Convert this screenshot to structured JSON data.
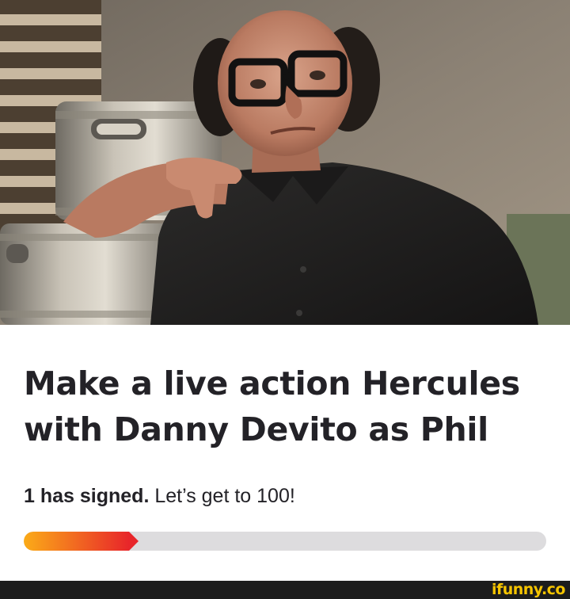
{
  "hero": {
    "image_name": "man-leaning-on-beer-kegs-photo"
  },
  "petition": {
    "title": "Make a live action Hercules with Danny Devito as Phil",
    "signed_count_text": "1 has signed.",
    "goal_text": " Let’s get to 100!",
    "progress_fraction": 0.22,
    "progress_colors": [
      "#fbab18",
      "#e8262a"
    ],
    "track_color": "#dddcde"
  },
  "footer": {
    "watermark": "ifunny.co",
    "watermark_color": "#f5c400"
  }
}
